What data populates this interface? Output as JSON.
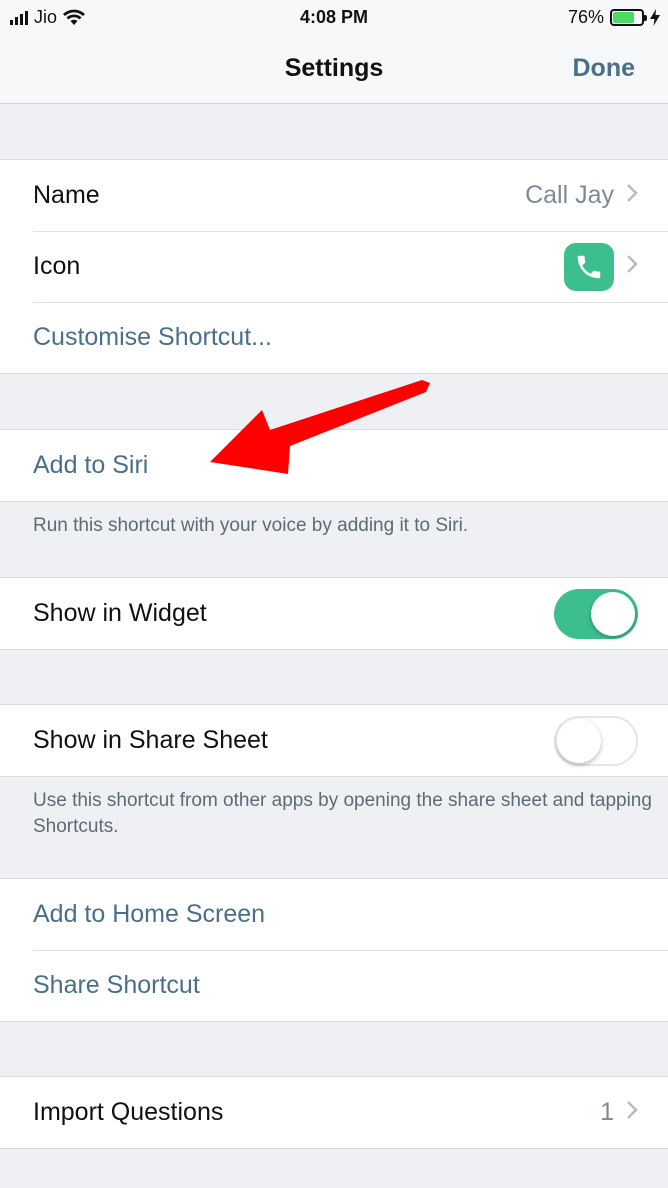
{
  "status": {
    "carrier": "Jio",
    "time": "4:08 PM",
    "battery": "76%",
    "battery_level": 0.76
  },
  "nav": {
    "title": "Settings",
    "done": "Done"
  },
  "rows": {
    "name_label": "Name",
    "name_value": "Call Jay",
    "icon_label": "Icon",
    "customise": "Customise Shortcut...",
    "add_to_siri": "Add to Siri",
    "siri_footer": "Run this shortcut with your voice by adding it to Siri.",
    "widget_label": "Show in Widget",
    "widget_on": true,
    "share_sheet_label": "Show in Share Sheet",
    "share_sheet_on": false,
    "share_sheet_footer": "Use this shortcut from other apps by opening the share sheet and tapping Shortcuts.",
    "add_home": "Add to Home Screen",
    "share_shortcut": "Share Shortcut",
    "import_label": "Import Questions",
    "import_value": "1"
  },
  "colors": {
    "accent": "#4a6f8a",
    "toggle_on": "#3dbf8d",
    "arrow": "#ff0000"
  },
  "icons": [
    "signal-bars-icon",
    "wifi-icon",
    "battery-icon",
    "charging-bolt-icon",
    "chevron-right-icon",
    "phone-icon",
    "red-arrow-annotation"
  ]
}
